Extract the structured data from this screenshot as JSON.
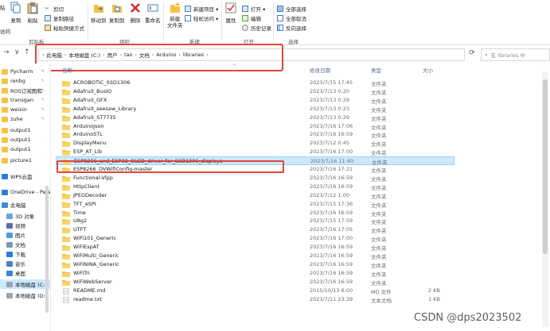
{
  "ribbon": {
    "left_fragment_top": "贴",
    "left_fragment_bottom": "访问",
    "copy_label": "复制",
    "paste_label": "粘贴",
    "cut_label": "剪切",
    "copy_path_label": "复制路径",
    "paste_shortcut_label": "粘贴快捷方式",
    "clipboard_group": "剪贴板",
    "move_to_label": "移动到",
    "copy_to_label": "复制到",
    "delete_label": "删除",
    "rename_label": "重命名",
    "organize_group": "组织",
    "new_folder_label": "新建\n文件夹",
    "new_item_label": "新建项目 ▾",
    "easy_access_label": "轻松访问 ▾",
    "new_group": "新建",
    "properties_label": "属性",
    "open_label": "打开 ▾",
    "edit_label": "编辑",
    "history_label": "历史记录",
    "open_group": "打开",
    "select_all_label": "全部选择",
    "select_none_label": "全部取消",
    "invert_label": "反向选择",
    "select_group": "选择"
  },
  "address": {
    "crumbs": [
      "此电脑",
      "本地磁盘 (C:)",
      "用户",
      "tao",
      "文档",
      "Arduino",
      "libraries"
    ],
    "search_placeholder": "在 libraries 中"
  },
  "sidebar": {
    "items": [
      {
        "label": "Pycharm",
        "pinned": true,
        "icon": "folder-icon"
      },
      {
        "label": "renbg",
        "pinned": true,
        "icon": "folder-icon"
      },
      {
        "label": "ROS订阅图和",
        "pinned": true,
        "icon": "folder-icon"
      },
      {
        "label": "transgan",
        "pinned": true,
        "icon": "folder-icon"
      },
      {
        "label": "weixin",
        "pinned": true,
        "icon": "folder-icon"
      },
      {
        "label": "zuhe",
        "pinned": true,
        "icon": "folder-icon"
      },
      {
        "label": "output1",
        "pinned": false,
        "icon": "folder-icon"
      },
      {
        "label": "output1",
        "pinned": false,
        "icon": "folder-icon"
      },
      {
        "label": "output1",
        "pinned": false,
        "icon": "folder-icon"
      },
      {
        "label": "picture1",
        "pinned": false,
        "icon": "folder-icon"
      },
      {
        "label": "WPS云盘",
        "pinned": false,
        "icon": "cloud-icon"
      },
      {
        "label": "OneDrive - Persc",
        "pinned": false,
        "icon": "onedrive-icon"
      },
      {
        "label": "此电脑",
        "pinned": false,
        "icon": "computer-icon"
      },
      {
        "label": "3D 对象",
        "pinned": false,
        "icon": "3d-objects-icon"
      },
      {
        "label": "视频",
        "pinned": false,
        "icon": "video-icon"
      },
      {
        "label": "图片",
        "pinned": false,
        "icon": "pictures-icon"
      },
      {
        "label": "文档",
        "pinned": false,
        "icon": "documents-icon"
      },
      {
        "label": "下载",
        "pinned": false,
        "icon": "downloads-icon"
      },
      {
        "label": "音乐",
        "pinned": false,
        "icon": "music-icon"
      },
      {
        "label": "桌面",
        "pinned": false,
        "icon": "desktop-icon"
      },
      {
        "label": "本地磁盘 (C:)",
        "pinned": false,
        "icon": "drive-icon"
      },
      {
        "label": "本地磁盘 (D:)",
        "pinned": false,
        "icon": "drive-icon"
      }
    ]
  },
  "columns": {
    "name": "名称",
    "date": "修改日期",
    "type": "类型",
    "size": "大小"
  },
  "files": [
    {
      "name": "ACROBOTIC_SSD1306",
      "date": "2023/7/15 17:45",
      "type": "文件夹",
      "size": "",
      "kind": "folder"
    },
    {
      "name": "Adafruit_BusIO",
      "date": "2023/7/13 0:20",
      "type": "文件夹",
      "size": "",
      "kind": "folder"
    },
    {
      "name": "Adafruit_GFX",
      "date": "2023/7/13 0:29",
      "type": "文件夹",
      "size": "",
      "kind": "folder"
    },
    {
      "name": "Adafruit_seesaw_Library",
      "date": "2023/7/13 0:23",
      "type": "文件夹",
      "size": "",
      "kind": "folder"
    },
    {
      "name": "Adafruit_ST7735",
      "date": "2023/7/13 0:29",
      "type": "文件夹",
      "size": "",
      "kind": "folder"
    },
    {
      "name": "ArduinoJson",
      "date": "2023/7/16 17:06",
      "type": "文件夹",
      "size": "",
      "kind": "folder"
    },
    {
      "name": "ArduinoSTL",
      "date": "2023/7/16 16:59",
      "type": "文件夹",
      "size": "",
      "kind": "folder"
    },
    {
      "name": "DisplayMenu",
      "date": "2023/7/12 0:45",
      "type": "文件夹",
      "size": "",
      "kind": "folder"
    },
    {
      "name": "ESP_AT_Lib",
      "date": "2023/7/16 17:00",
      "type": "文件夹",
      "size": "",
      "kind": "folder"
    },
    {
      "name": "ESP8266_and_ESP32_OLED_driver_for_SSD1306_displays",
      "date": "2023/7/16 11:40",
      "type": "文件夹",
      "size": "",
      "kind": "folder"
    },
    {
      "name": "ESP8266_DVWifiConfig-master",
      "date": "2023/7/16 17:21",
      "type": "文件夹",
      "size": "",
      "kind": "folder"
    },
    {
      "name": "Functional-Vlpp",
      "date": "2023/7/16 16:59",
      "type": "文件夹",
      "size": "",
      "kind": "folder"
    },
    {
      "name": "HttpClient",
      "date": "2023/7/16 16:59",
      "type": "文件夹",
      "size": "",
      "kind": "folder"
    },
    {
      "name": "JPEGDecoder",
      "date": "2023/7/12 1:00",
      "type": "文件夹",
      "size": "",
      "kind": "folder"
    },
    {
      "name": "TFT_eSPI",
      "date": "2023/7/15 17:36",
      "type": "文件夹",
      "size": "",
      "kind": "folder"
    },
    {
      "name": "Time",
      "date": "2023/7/16 16:59",
      "type": "文件夹",
      "size": "",
      "kind": "folder"
    },
    {
      "name": "U8g2",
      "date": "2023/7/15 17:59",
      "type": "文件夹",
      "size": "",
      "kind": "folder"
    },
    {
      "name": "UTFT",
      "date": "2023/7/16 17:05",
      "type": "文件夹",
      "size": "",
      "kind": "folder"
    },
    {
      "name": "WiFi101_Generic",
      "date": "2023/7/16 17:00",
      "type": "文件夹",
      "size": "",
      "kind": "folder"
    },
    {
      "name": "WiFiEspAT",
      "date": "2023/7/16 16:59",
      "type": "文件夹",
      "size": "",
      "kind": "folder"
    },
    {
      "name": "WiFiMulti_Generic",
      "date": "2023/7/16 16:59",
      "type": "文件夹",
      "size": "",
      "kind": "folder"
    },
    {
      "name": "WiFiNINA_Generic",
      "date": "2023/7/16 16:59",
      "type": "文件夹",
      "size": "",
      "kind": "folder"
    },
    {
      "name": "WiFiTri",
      "date": "2023/7/16 16:59",
      "type": "文件夹",
      "size": "",
      "kind": "folder"
    },
    {
      "name": "WiFiWebServer",
      "date": "2023/7/16 16:59",
      "type": "文件夹",
      "size": "",
      "kind": "folder"
    },
    {
      "name": "README.md",
      "date": "2015/10/13 6:00",
      "type": "MD 文件",
      "size": "2 KB",
      "kind": "file"
    },
    {
      "name": "readme.txt",
      "date": "2023/7/11 23:39",
      "type": "文本文档",
      "size": "1 KB",
      "kind": "file"
    }
  ],
  "selected_index": 9,
  "watermark": "CSDN @dps2023502",
  "colors": {
    "accent_highlight": "#e0463a",
    "selection": "#cce8ff",
    "folder": "#f5c342"
  }
}
